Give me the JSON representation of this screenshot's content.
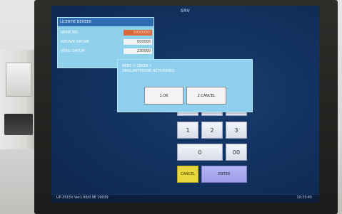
{
  "screen": {
    "title": "SRV",
    "licence": {
      "header": "LICENTIE BEHEER",
      "rows": [
        {
          "label": "SERIE NO",
          "value": "XXXXXXX"
        },
        {
          "label": "NIEUWE DATUM",
          "value": "000000"
        },
        {
          "label": "VERV. DATUM",
          "value": "230000"
        }
      ]
    },
    "dialog": {
      "line1": "BENT U ZEKER ?",
      "line2": "ONGLIMITEERDE ACTIVERING",
      "buttons": {
        "ok": "1.OK",
        "cancel": "2.CANCEL"
      }
    },
    "keypad": {
      "keys": [
        "1",
        "2",
        "3",
        "0",
        "00"
      ],
      "cancel_label": "CANCEL",
      "enter_label": "ENTER"
    },
    "statusbar": {
      "left": "UP-3515V  Ver1.60/0.9E  29039",
      "right": "10:33:45"
    }
  },
  "colors": {
    "screen_bg": "#123260",
    "panel_light": "#8fd0ea",
    "panel_header": "#2f6db3",
    "cancel_key": "#e6d83d",
    "enter_key": "#b6b6f6",
    "serial_highlight": "#d86b3a"
  }
}
